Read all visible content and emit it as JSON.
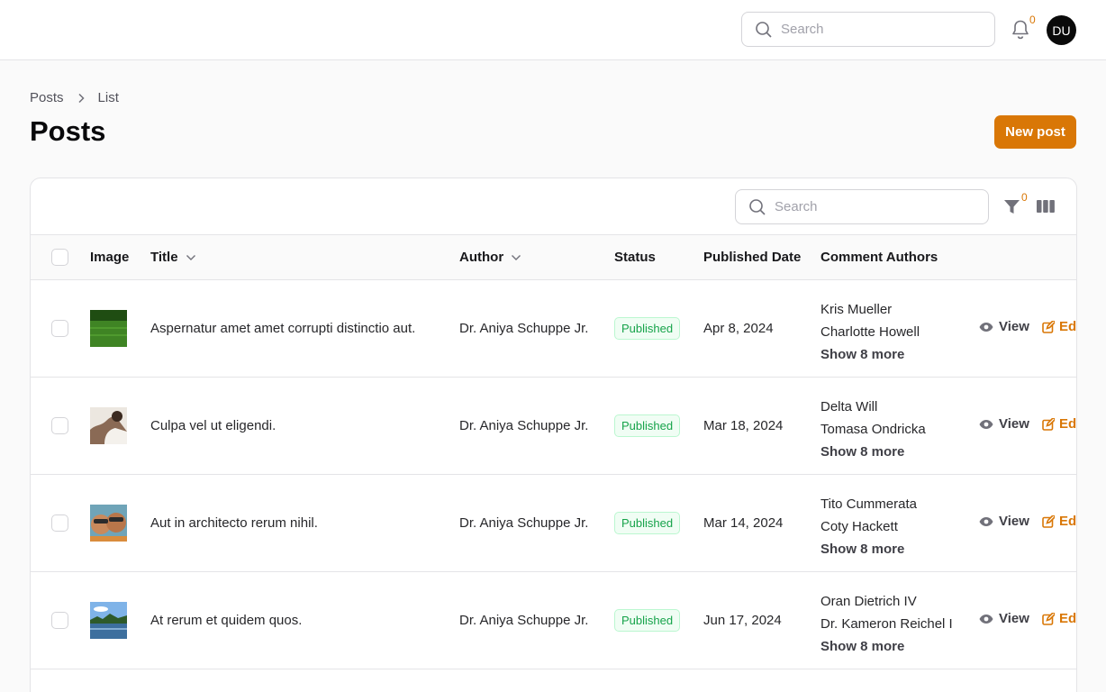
{
  "topbar": {
    "search_placeholder": "Search",
    "notification_count": "0",
    "avatar_initials": "DU"
  },
  "breadcrumb": {
    "items": [
      "Posts",
      "List"
    ]
  },
  "page": {
    "title": "Posts",
    "new_button": "New post"
  },
  "table": {
    "search_placeholder": "Search",
    "filter_count": "0",
    "columns": {
      "image": "Image",
      "title": "Title",
      "author": "Author",
      "status": "Status",
      "published_date": "Published Date",
      "comment_authors": "Comment Authors"
    },
    "actions": {
      "view": "View",
      "edit": "Edit"
    },
    "rows": [
      {
        "title": "Aspernatur amet amet corrupti distinctio aut.",
        "author": "Dr. Aniya Schuppe Jr.",
        "status": "Published",
        "date": "Apr 8, 2024",
        "comment1": "Kris Mueller",
        "comment2": "Charlotte Howell",
        "more": "Show 8 more",
        "image": "grass"
      },
      {
        "title": "Culpa vel ut eligendi.",
        "author": "Dr. Aniya Schuppe Jr.",
        "status": "Published",
        "date": "Mar 18, 2024",
        "comment1": "Delta Will",
        "comment2": "Tomasa Ondricka",
        "more": "Show 8 more",
        "image": "portrait"
      },
      {
        "title": "Aut in architecto rerum nihil.",
        "author": "Dr. Aniya Schuppe Jr.",
        "status": "Published",
        "date": "Mar 14, 2024",
        "comment1": "Tito Cummerata",
        "comment2": "Coty Hackett",
        "more": "Show 8 more",
        "image": "people"
      },
      {
        "title": "At rerum et quidem quos.",
        "author": "Dr. Aniya Schuppe Jr.",
        "status": "Published",
        "date": "Jun 17, 2024",
        "comment1": "Oran Dietrich IV",
        "comment2": "Dr. Kameron Reichel I",
        "more": "Show 8 more",
        "image": "lake"
      }
    ]
  },
  "colors": {
    "accent": "#d97706",
    "status_green": "#16a34a"
  }
}
